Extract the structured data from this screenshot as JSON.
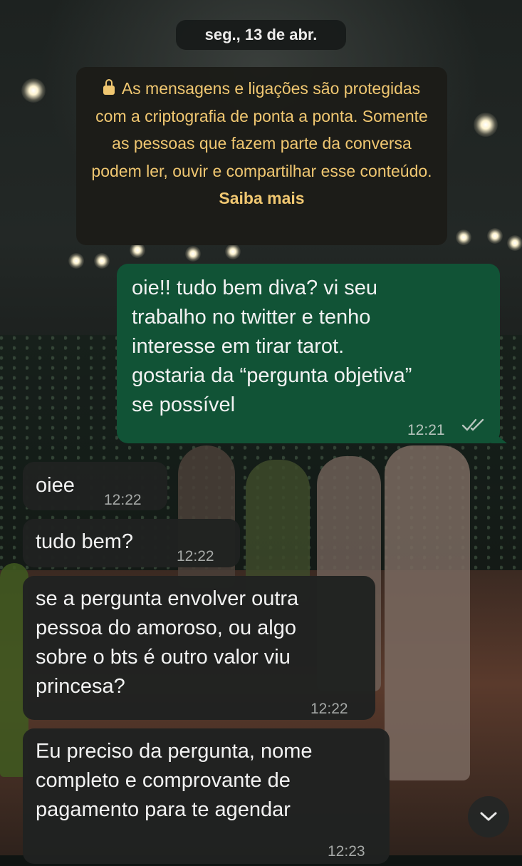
{
  "date_label": "seg., 13 de abr.",
  "encryption_notice": {
    "text": "As mensagens e ligações são protegidas com a criptografia de ponta a ponta. Somente as pessoas que fazem parte da conversa podem ler, ouvir e compartilhar esse conteúdo.",
    "link_label": "Saiba mais"
  },
  "messages": [
    {
      "direction": "outgoing",
      "text": "oie!! tudo bem diva? vi seu\ntrabalho no twitter e tenho\ninteresse em tirar tarot.\ngostaria da “pergunta objetiva”\nse possível",
      "time": "12:21",
      "status": "read-double-check"
    },
    {
      "direction": "incoming",
      "text": "oiee",
      "time": "12:22"
    },
    {
      "direction": "incoming",
      "text": "tudo bem?",
      "time": "12:22"
    },
    {
      "direction": "incoming",
      "text": "se a pergunta envolver outra\npessoa do amoroso, ou algo\nsobre o bts é outro valor viu\nprincesa?",
      "time": "12:22"
    },
    {
      "direction": "incoming",
      "text": "Eu preciso da pergunta, nome\ncompleto e comprovante de\npagamento para te agendar",
      "time": "12:23"
    }
  ],
  "icons": {
    "lock": "lock-icon",
    "read_receipt": "double-check-icon",
    "scroll_down": "chevron-down-icon"
  },
  "colors": {
    "outgoing_bubble": "#115336",
    "incoming_bubble": "#202221",
    "notice_text": "#f0c771"
  }
}
